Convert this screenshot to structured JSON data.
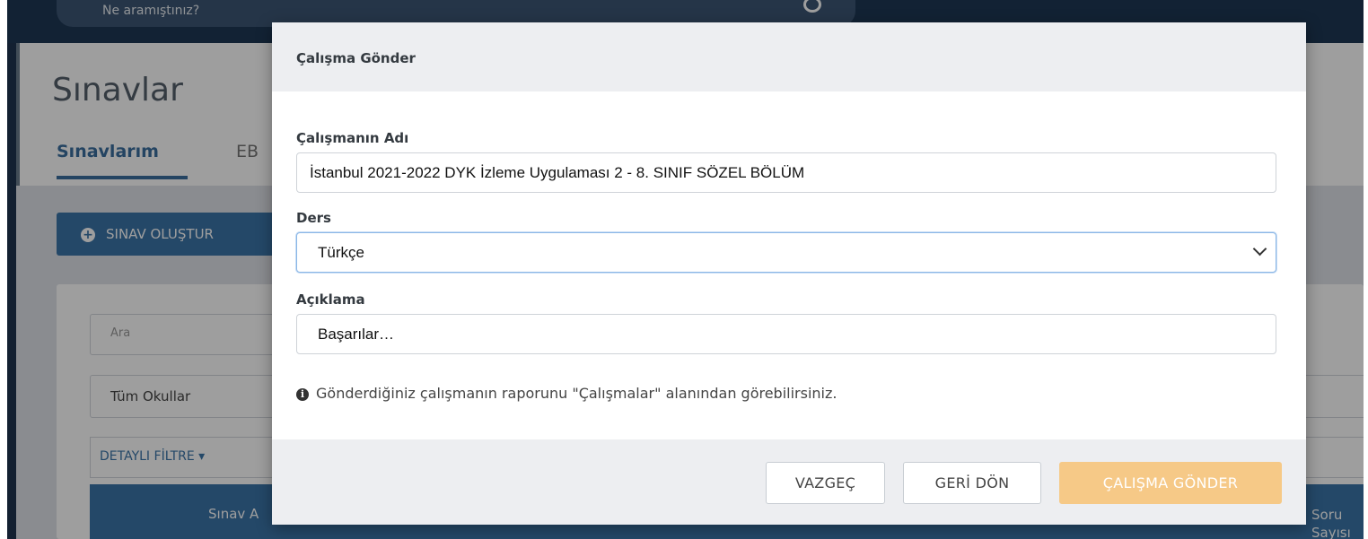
{
  "topbar": {
    "search_placeholder": "Ne aramıştınız?"
  },
  "page": {
    "title": "Sınavlar",
    "tabs": [
      {
        "label": "Sınavlarım",
        "active": true
      },
      {
        "label": "EB",
        "active": false
      }
    ],
    "create_button": "SINAV OLUŞTUR",
    "filter_search_placeholder": "Ara",
    "filter_school": "Tüm Okullar",
    "detailed_filter": "DETAYLI FİLTRE ▾",
    "table_headers": [
      "Sınav A",
      "Soru Sayısı"
    ]
  },
  "modal": {
    "title": "Çalışma Gönder",
    "name_label": "Çalışmanın Adı",
    "name_value": "İstanbul 2021-2022  DYK  İzleme Uygulaması 2 - 8. SINIF SÖZEL BÖLÜM",
    "lesson_label": "Ders",
    "lesson_value": "Türkçe",
    "description_label": "Açıklama",
    "description_value": "Başarılar…",
    "info_text": "Gönderdiğiniz çalışmanın raporunu \"Çalışmalar\" alanından görebilirsiniz.",
    "buttons": {
      "cancel": "VAZGEÇ",
      "back": "GERİ DÖN",
      "send": "ÇALIŞMA GÖNDER"
    }
  },
  "colors": {
    "primary": "#3b74a8",
    "send_button_disabled": "#f6c987",
    "topbar": "#1e3855"
  }
}
